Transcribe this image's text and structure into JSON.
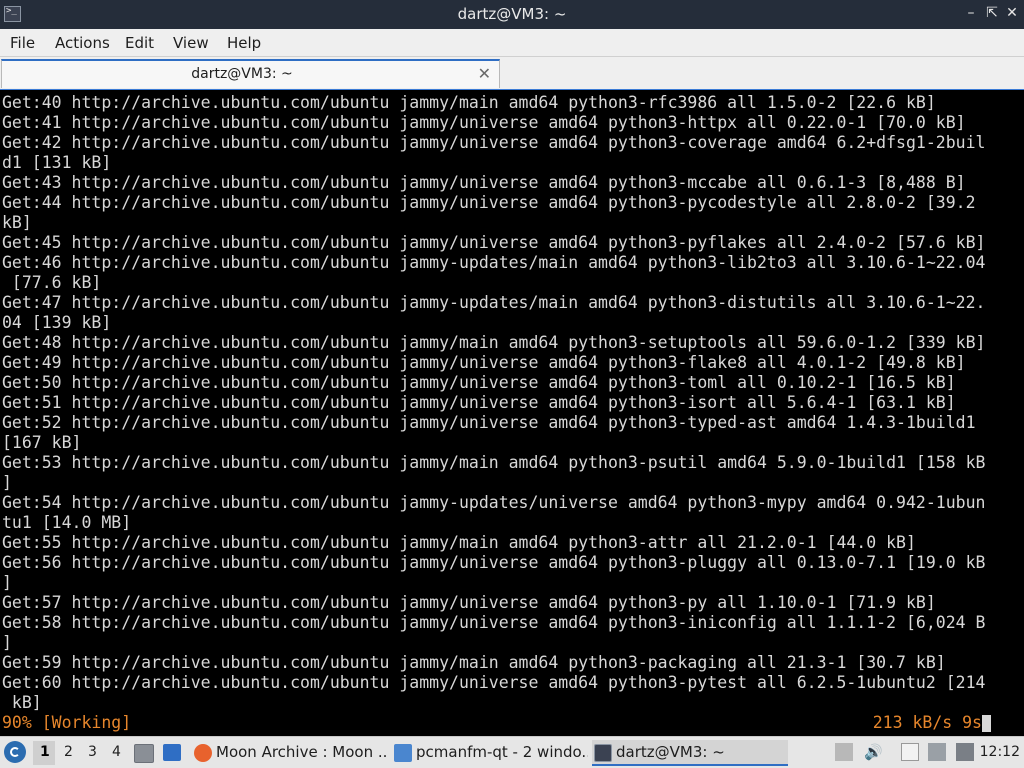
{
  "window": {
    "title": "dartz@VM3: ~"
  },
  "menubar": {
    "items": [
      "File",
      "Actions",
      "Edit",
      "View",
      "Help"
    ]
  },
  "tab": {
    "label": "dartz@VM3: ~"
  },
  "terminal": {
    "lines": [
      "Get:40 http://archive.ubuntu.com/ubuntu jammy/main amd64 python3-rfc3986 all 1.5.0-2 [22.6 kB]",
      "Get:41 http://archive.ubuntu.com/ubuntu jammy/universe amd64 python3-httpx all 0.22.0-1 [70.0 kB]",
      "Get:42 http://archive.ubuntu.com/ubuntu jammy/universe amd64 python3-coverage amd64 6.2+dfsg1-2buil",
      "d1 [131 kB]",
      "Get:43 http://archive.ubuntu.com/ubuntu jammy/universe amd64 python3-mccabe all 0.6.1-3 [8,488 B]",
      "Get:44 http://archive.ubuntu.com/ubuntu jammy/universe amd64 python3-pycodestyle all 2.8.0-2 [39.2",
      "kB]",
      "Get:45 http://archive.ubuntu.com/ubuntu jammy/universe amd64 python3-pyflakes all 2.4.0-2 [57.6 kB]",
      "Get:46 http://archive.ubuntu.com/ubuntu jammy-updates/main amd64 python3-lib2to3 all 3.10.6-1~22.04",
      " [77.6 kB]",
      "Get:47 http://archive.ubuntu.com/ubuntu jammy-updates/main amd64 python3-distutils all 3.10.6-1~22.",
      "04 [139 kB]",
      "Get:48 http://archive.ubuntu.com/ubuntu jammy/main amd64 python3-setuptools all 59.6.0-1.2 [339 kB]",
      "Get:49 http://archive.ubuntu.com/ubuntu jammy/universe amd64 python3-flake8 all 4.0.1-2 [49.8 kB]",
      "Get:50 http://archive.ubuntu.com/ubuntu jammy/universe amd64 python3-toml all 0.10.2-1 [16.5 kB]",
      "Get:51 http://archive.ubuntu.com/ubuntu jammy/universe amd64 python3-isort all 5.6.4-1 [63.1 kB]",
      "Get:52 http://archive.ubuntu.com/ubuntu jammy/universe amd64 python3-typed-ast amd64 1.4.3-1build1",
      "[167 kB]",
      "Get:53 http://archive.ubuntu.com/ubuntu jammy/main amd64 python3-psutil amd64 5.9.0-1build1 [158 kB",
      "]",
      "Get:54 http://archive.ubuntu.com/ubuntu jammy-updates/universe amd64 python3-mypy amd64 0.942-1ubun",
      "tu1 [14.0 MB]",
      "Get:55 http://archive.ubuntu.com/ubuntu jammy/main amd64 python3-attr all 21.2.0-1 [44.0 kB]",
      "Get:56 http://archive.ubuntu.com/ubuntu jammy/universe amd64 python3-pluggy all 0.13.0-7.1 [19.0 kB",
      "]",
      "Get:57 http://archive.ubuntu.com/ubuntu jammy/universe amd64 python3-py all 1.10.0-1 [71.9 kB]",
      "Get:58 http://archive.ubuntu.com/ubuntu jammy/universe amd64 python3-iniconfig all 1.1.1-2 [6,024 B",
      "]",
      "Get:59 http://archive.ubuntu.com/ubuntu jammy/main amd64 python3-packaging all 21.3-1 [30.7 kB]",
      "Get:60 http://archive.ubuntu.com/ubuntu jammy/universe amd64 python3-pytest all 6.2.5-1ubuntu2 [214",
      " kB]"
    ],
    "status_left": "90% [Working]",
    "status_right": "213 kB/s 9s",
    "colors": {
      "background": "#000000",
      "text": "#d8d8d8",
      "status": "#e6862c",
      "accent": "#3b7bd6"
    }
  },
  "taskbar": {
    "desktops": [
      "1",
      "2",
      "3",
      "4"
    ],
    "active_desktop": "1",
    "quick_launch": [
      "file-manager-icon",
      "desktop-icon"
    ],
    "tasks": [
      {
        "label": "Moon Archive : Moon ...",
        "icon": "firefox-icon",
        "active": false
      },
      {
        "label": "pcmanfm-qt - 2 windo...",
        "icon": "folder-icon",
        "active": false
      },
      {
        "label": "dartz@VM3: ~",
        "icon": "terminal-icon",
        "active": true
      }
    ],
    "tray": [
      "removable-drive-icon",
      "volume-icon",
      "clipboard-icon",
      "network-icon",
      "keyboard-icon"
    ],
    "clock": "12:12"
  }
}
